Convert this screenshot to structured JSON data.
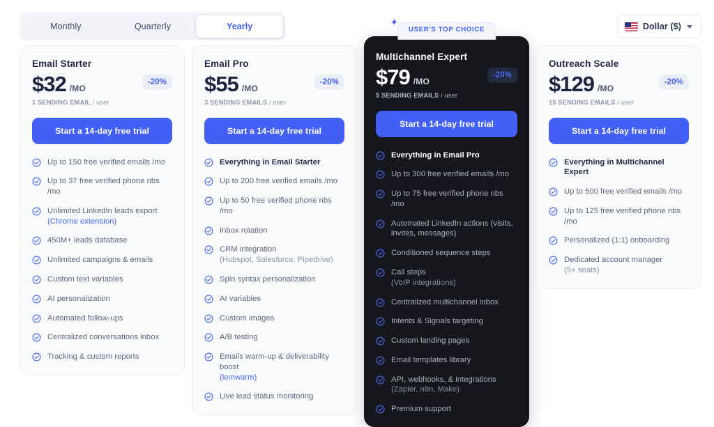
{
  "billing_tabs": {
    "items": [
      {
        "label": "Monthly",
        "active": false
      },
      {
        "label": "Quarterly",
        "active": false
      },
      {
        "label": "Yearly",
        "active": true
      }
    ]
  },
  "currency_selector": {
    "label": "Dollar  ($)",
    "flag": "us-flag-icon",
    "chevron": "chevron-down-icon"
  },
  "featured_badge": {
    "label": "USER'S TOP CHOICE",
    "icon": "sparkle-icon"
  },
  "plans": [
    {
      "name": "Email Starter",
      "price": "$32",
      "period": "/MO",
      "discount": "-20%",
      "seats": "1 SENDING EMAIL",
      "seats_unit": "/ user",
      "cta": "Start a 14-day free trial",
      "featured": false,
      "features": [
        {
          "text": "Up to 150 free verified emails /mo"
        },
        {
          "text": "Up to 37 free verified phone nbs /mo"
        },
        {
          "text": "Unlimited LinkedIn leads export",
          "sub": "(Chrome extension)",
          "sub_accent": true
        },
        {
          "text": "450M+ leads database"
        },
        {
          "text": "Unlimited campaigns & emails"
        },
        {
          "text": "Custom text variables"
        },
        {
          "text": "AI personalization"
        },
        {
          "text": "Automated follow-ups"
        },
        {
          "text": "Centralized conversations inbox"
        },
        {
          "text": "Tracking & custom reports"
        }
      ]
    },
    {
      "name": "Email Pro",
      "price": "$55",
      "period": "/MO",
      "discount": "-20%",
      "seats": "3 SENDING EMAILS",
      "seats_unit": "/ user",
      "cta": "Start a 14-day free trial",
      "featured": false,
      "features": [
        {
          "text": "Everything in Email Starter",
          "bold": true
        },
        {
          "text": "Up to 200 free verified emails /mo"
        },
        {
          "text": "Up to 50 free verified phone nbs /mo"
        },
        {
          "text": "Inbox rotation"
        },
        {
          "text": "CRM integration",
          "sub": "(Hubspot, Salesforce, Pipedrive)"
        },
        {
          "text": "Spin syntax personalization"
        },
        {
          "text": "AI variables"
        },
        {
          "text": "Custom images"
        },
        {
          "text": "A/B testing"
        },
        {
          "text": "Emails warm-up & deliverability boost",
          "sub": "(lemwarm)",
          "sub_accent": true
        },
        {
          "text": "Live lead status monitoring"
        }
      ]
    },
    {
      "name": "Multichannel Expert",
      "price": "$79",
      "period": "/MO",
      "discount": "-20%",
      "seats": "5 SENDING EMAILS",
      "seats_unit": "/ user",
      "cta": "Start a 14-day free trial",
      "featured": true,
      "features": [
        {
          "text": "Everything in Email Pro",
          "bold": true
        },
        {
          "text": "Up to 300 free verified emails /mo"
        },
        {
          "text": "Up to 75 free verified phone nbs /mo"
        },
        {
          "text": "Automated LinkedIn actions (visits, invites, messages)"
        },
        {
          "text": "Conditioned sequence steps"
        },
        {
          "text": "Call steps",
          "sub": "(VoIP integrations)"
        },
        {
          "text": "Centralized multichannel inbox"
        },
        {
          "text": "Intents & Signals targeting"
        },
        {
          "text": "Custom landing pages"
        },
        {
          "text": "Email templates library"
        },
        {
          "text": "API, webhooks, & integrations",
          "sub": "(Zapier, n8n, Make)"
        },
        {
          "text": "Premium support"
        }
      ]
    },
    {
      "name": "Outreach Scale",
      "price": "$129",
      "period": "/MO",
      "discount": "-20%",
      "seats": "15 SENDING EMAILS",
      "seats_unit": "/ user",
      "cta": "Start a 14-day free trial",
      "featured": false,
      "features": [
        {
          "text": "Everything in Multichannel Expert",
          "bold": true
        },
        {
          "text": "Up to 500 free verified emails /mo"
        },
        {
          "text": "Up to 125 free verified phone nbs /mo"
        },
        {
          "text": "Personalized (1:1) onboarding"
        },
        {
          "text": "Dedicated account manager",
          "sub": "(5+ seats)"
        }
      ]
    }
  ],
  "colors": {
    "accent": "#4260f5",
    "dark_card": "#15171c",
    "card_bg": "#fafbfd",
    "text": "#222b45",
    "muted": "#5c6479"
  }
}
